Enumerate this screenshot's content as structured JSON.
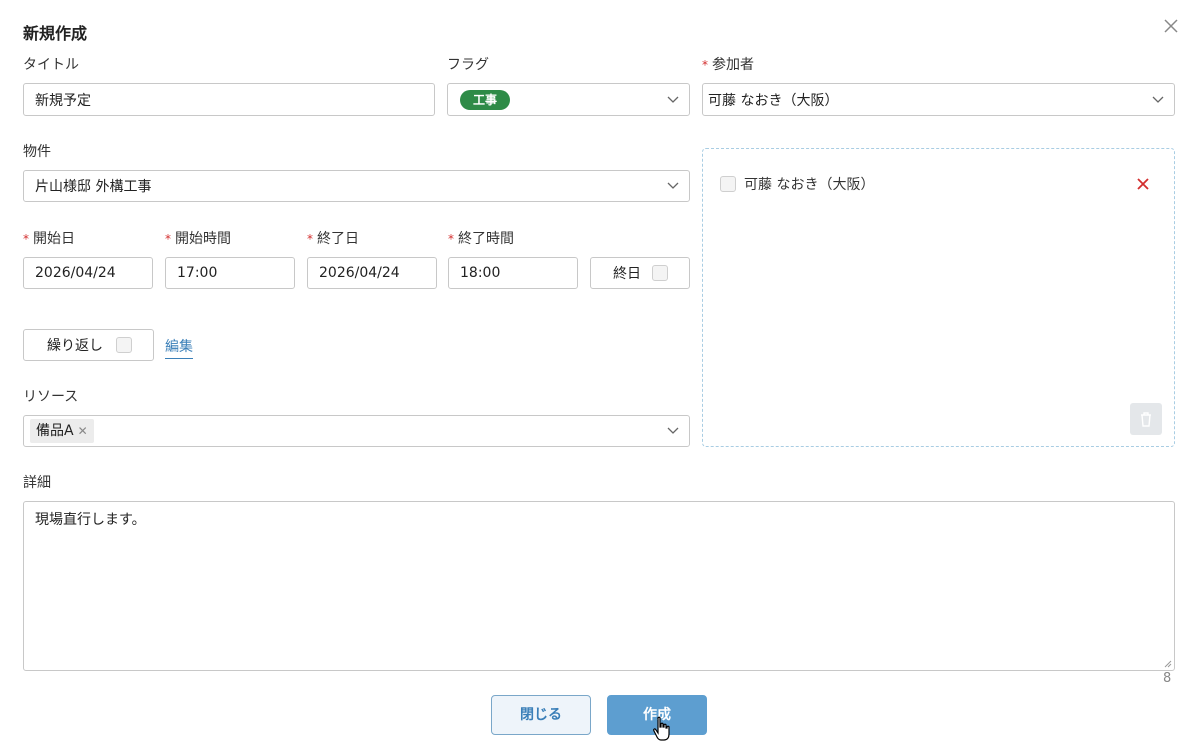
{
  "dialog": {
    "title": "新規作成"
  },
  "form": {
    "title_label": "タイトル",
    "title_value": "新規予定",
    "flag_label": "フラグ",
    "flag_value": "工事",
    "flag_color": "#2e8b47",
    "participants_label": "参加者",
    "participants_value": "可藤 なおき（大阪）",
    "property_label": "物件",
    "property_value": "片山様邸 外構工事",
    "start_date_label": "開始日",
    "start_date_value": "2026/04/24",
    "start_time_label": "開始時間",
    "start_time_value": "17:00",
    "end_date_label": "終了日",
    "end_date_value": "2026/04/24",
    "end_time_label": "終了時間",
    "end_time_value": "18:00",
    "all_day_label": "終日",
    "repeat_label": "繰り返し",
    "edit_link": "編集",
    "resource_label": "リソース",
    "resource_chip": "備品A",
    "details_label": "詳細",
    "details_value": "現場直行します。",
    "char_count": "8",
    "required_mark": "*"
  },
  "participants_list": {
    "items": [
      {
        "name": "可藤 なおき（大阪）"
      }
    ]
  },
  "footer": {
    "close_label": "閉じる",
    "create_label": "作成"
  },
  "icons": {
    "close": "close-icon",
    "chevron": "chevron-down-icon",
    "remove": "remove-x-icon",
    "trash": "trash-icon"
  },
  "colors": {
    "accent": "#5d9ed0",
    "link": "#3a7fb8",
    "remove": "#d32f2f",
    "flag": "#2e8b47"
  }
}
